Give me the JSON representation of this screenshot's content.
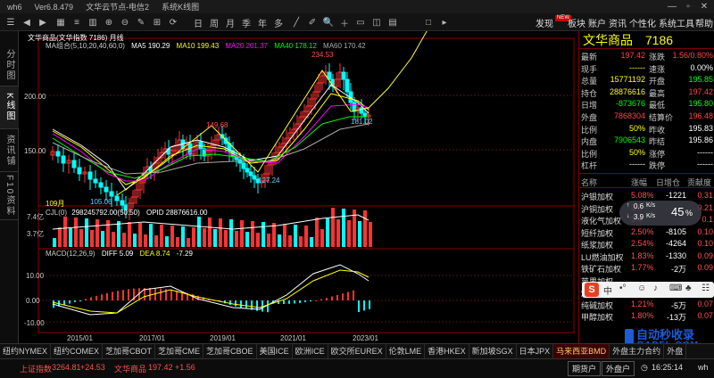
{
  "window": {
    "app_name": "wh6",
    "version": "Ver6.8.479",
    "server": "文华云节点-电信2",
    "view": "系统K线图"
  },
  "toolbar": {
    "menus": [
      "发现",
      "板块",
      "账户",
      "资讯",
      "个性化",
      "系统工具",
      "帮助"
    ],
    "new_badge": "NEW",
    "period_buttons": [
      "日",
      "周",
      "月",
      "季",
      "年",
      "多"
    ]
  },
  "left_tabs": [
    "分时图",
    "K线图",
    "资讯铺",
    "F10资料"
  ],
  "chart": {
    "title_line": "文华商品(文华指数 7186)  月线",
    "ma_legend": [
      {
        "label": "MA组合(5,10,20,40,60,0)",
        "color": "#cccccc"
      },
      {
        "label": "MA5 190.29",
        "color": "#ffffff"
      },
      {
        "label": "MA10 199.43",
        "color": "#ffff00"
      },
      {
        "label": "MA20 201.37",
        "color": "#ff00ff"
      },
      {
        "label": "MA40 178.12",
        "color": "#00ff00"
      },
      {
        "label": "MA60 170.42",
        "color": "#aaaaaa"
      }
    ],
    "price_ticks": [
      "200.00",
      "150.00"
    ],
    "annotations": {
      "high": "234.53",
      "mid_high": "149.68",
      "recent_low": "181.02",
      "low_2020": "127.24",
      "low_2016": "105.06",
      "count": "109月"
    },
    "volume_legend": [
      {
        "label": "CJL(0)",
        "color": "#cccccc"
      },
      {
        "label": "298245792.00(50:50)",
        "color": "#ffffff"
      },
      {
        "label": "OPID 28876616.00",
        "color": "#ffffff"
      }
    ],
    "volume_ticks": [
      "7.4亿",
      "3.7亿"
    ],
    "macd_legend": [
      {
        "label": "MACD(12,26,9)",
        "color": "#cccccc"
      },
      {
        "label": "DIFF 5.09",
        "color": "#ffffff"
      },
      {
        "label": "DEA 8.74",
        "color": "#ffff00"
      },
      {
        "label": "-7.29",
        "color": "#ffffff"
      }
    ],
    "macd_ticks": [
      "10.00",
      "0.00",
      "-10.00"
    ],
    "x_labels": [
      "2015/01",
      "2017/01",
      "2019/01",
      "2021/01",
      "2023/01"
    ]
  },
  "quote": {
    "name": "文华商品",
    "code": "7186",
    "rows": [
      {
        "l1": "最新",
        "v1": "197.42",
        "c1": "#ff4444",
        "l2": "涨跌",
        "v2": "1.56/0.80%",
        "c2": "#ff4444"
      },
      {
        "l1": "现手",
        "v1": "------",
        "c1": "#ffff00",
        "l2": "速涨",
        "v2": "0.00%",
        "c2": "#ffffff"
      },
      {
        "l1": "总量",
        "v1": "15771192",
        "c1": "#ffff00",
        "l2": "开盘",
        "v2": "195.85",
        "c2": "#00ff00"
      },
      {
        "l1": "持仓",
        "v1": "28876616",
        "c1": "#ffff00",
        "l2": "最高",
        "v2": "197.42",
        "c2": "#ff4444"
      },
      {
        "l1": "日增",
        "v1": "-873676",
        "c1": "#00ff00",
        "l2": "最低",
        "v2": "195.80",
        "c2": "#00ff00"
      },
      {
        "l1": "外盘",
        "v1": "7868304",
        "c1": "#ff4444",
        "l2": "结算价",
        "v2": "196.48",
        "c2": "#ff4444"
      },
      {
        "l1": "比例",
        "v1": "50%",
        "c1": "#ffff00",
        "l2": "昨收",
        "v2": "195.83",
        "c2": "#ffffff"
      },
      {
        "l1": "内盘",
        "v1": "7906543",
        "c1": "#00ff00",
        "l2": "昨结",
        "v2": "195.86",
        "c2": "#ffffff"
      },
      {
        "l1": "比例",
        "v1": "50%",
        "c1": "#ffff00",
        "l2": "涨停",
        "v2": "------",
        "c2": "#ffffff"
      },
      {
        "l1": "杠杆",
        "v1": "------",
        "c1": "#ffffff",
        "l2": "跌停",
        "v2": "------",
        "c2": "#ffffff"
      }
    ],
    "list_header": [
      "名称",
      "涨幅",
      "日增仓",
      "贡献度"
    ],
    "list": [
      {
        "name": "沪银加权",
        "chg": "5.08%",
        "oi": "-1221",
        "contrib": "0.31"
      },
      {
        "name": "沪铜加权",
        "chg": "3.8",
        "oi": "",
        "contrib": "0.21"
      },
      {
        "name": "液化气加权",
        "chg": "3.4",
        "oi": "",
        "contrib": "0.1"
      },
      {
        "name": "短纤加权",
        "chg": "2.50%",
        "oi": "-8105",
        "contrib": "0.10"
      },
      {
        "name": "纸浆加权",
        "chg": "2.54%",
        "oi": "-4264",
        "contrib": "0.10"
      },
      {
        "name": "LU燃油加权",
        "chg": "1.83%",
        "oi": "-1330",
        "contrib": "0.09"
      },
      {
        "name": "铁矿石加权",
        "chg": "1.77%",
        "oi": "-2万",
        "contrib": "0.09"
      },
      {
        "name": "苹果加权",
        "chg": "",
        "oi": "",
        "contrib": ""
      },
      {
        "name": "燃",
        "chg": "",
        "oi": "",
        "contrib": ""
      },
      {
        "name": "纯碱加权",
        "chg": "1.21%",
        "oi": "-5万",
        "contrib": "0.07"
      },
      {
        "name": "甲醇加权",
        "chg": "1.80%",
        "oi": "-13万",
        "contrib": "0.07"
      }
    ],
    "pct_widget": {
      "pct": "45",
      "unit": "%",
      "up": "0.6",
      "down": "3.9",
      "rate_unit": "K/s"
    }
  },
  "bottom_tabs": [
    "纽约NYMEX",
    "纽约COMEX",
    "芝加哥CBOT",
    "芝加哥CME",
    "芝加哥CBOE",
    "美国ICE",
    "欧洲ICE",
    "欧交所EUREX",
    "伦敦LME",
    "香港HKEX",
    "新加坡SGX",
    "日本JPX",
    "马来西亚BMD",
    "外盘主力合约",
    "外盘"
  ],
  "active_bottom_tab": "马来西亚BMD",
  "status": {
    "index_name": "上证指数",
    "index_val": "3264.81",
    "index_chg": "+24.53",
    "product_name": "文华商品",
    "product_val": "197.42",
    "product_chg": "+1.56",
    "button1": "期货户",
    "button2": "外盘户",
    "time": "16:25:14",
    "user": "wh"
  },
  "watermark": {
    "title": "自动秒收录",
    "url": "BADFL.COM"
  },
  "colors": {
    "up": "#ff3333",
    "down": "#00ffff",
    "accent": "#ffff00",
    "panel_border": "#7a0000"
  }
}
